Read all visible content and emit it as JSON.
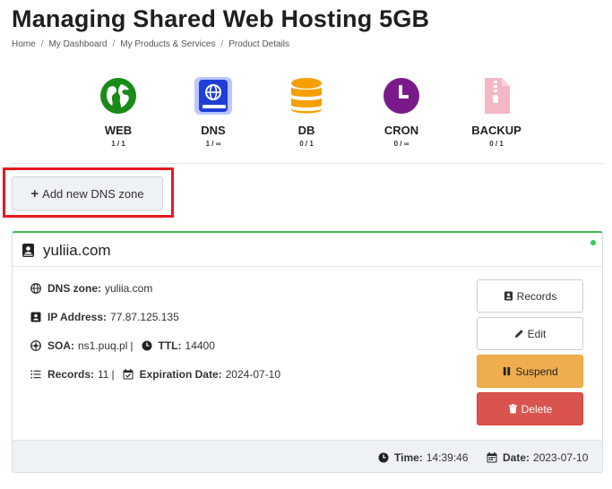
{
  "page": {
    "title": "Managing Shared Web Hosting 5GB",
    "breadcrumb": [
      "Home",
      "My Dashboard",
      "My Products & Services",
      "Product Details"
    ]
  },
  "services": [
    {
      "label": "WEB",
      "count": "1 / 1",
      "icon": "globe-icon",
      "color": "#1a8a1a"
    },
    {
      "label": "DNS",
      "count": "1 / ∞",
      "icon": "dns-book-icon",
      "color": "#1f3fd6"
    },
    {
      "label": "DB",
      "count": "0 / 1",
      "icon": "database-icon",
      "color": "#f5a000"
    },
    {
      "label": "CRON",
      "count": "0 / ∞",
      "icon": "clock-icon",
      "color": "#7a1a8a"
    },
    {
      "label": "BACKUP",
      "count": "0 / 1",
      "icon": "zip-file-icon",
      "color": "#f4b8c4"
    }
  ],
  "actions": {
    "add_zone": "Add new DNS zone"
  },
  "zone": {
    "name": "yuliia.com",
    "status_color": "#2ecc55",
    "dns_zone_label": "DNS zone:",
    "dns_zone_value": "yuliia.com",
    "ip_label": "IP Address:",
    "ip_value": "77.87.125.135",
    "soa_label": "SOA:",
    "soa_value": "ns1.puq.pl",
    "ttl_label": "TTL:",
    "ttl_value": "14400",
    "records_label": "Records:",
    "records_value": "11",
    "expiration_label": "Expiration Date:",
    "expiration_value": "2024-07-10",
    "buttons": {
      "records": "Records",
      "edit": "Edit",
      "suspend": "Suspend",
      "delete": "Delete"
    },
    "footer": {
      "time_label": "Time:",
      "time_value": "14:39:46",
      "date_label": "Date:",
      "date_value": "2023-07-10"
    }
  }
}
